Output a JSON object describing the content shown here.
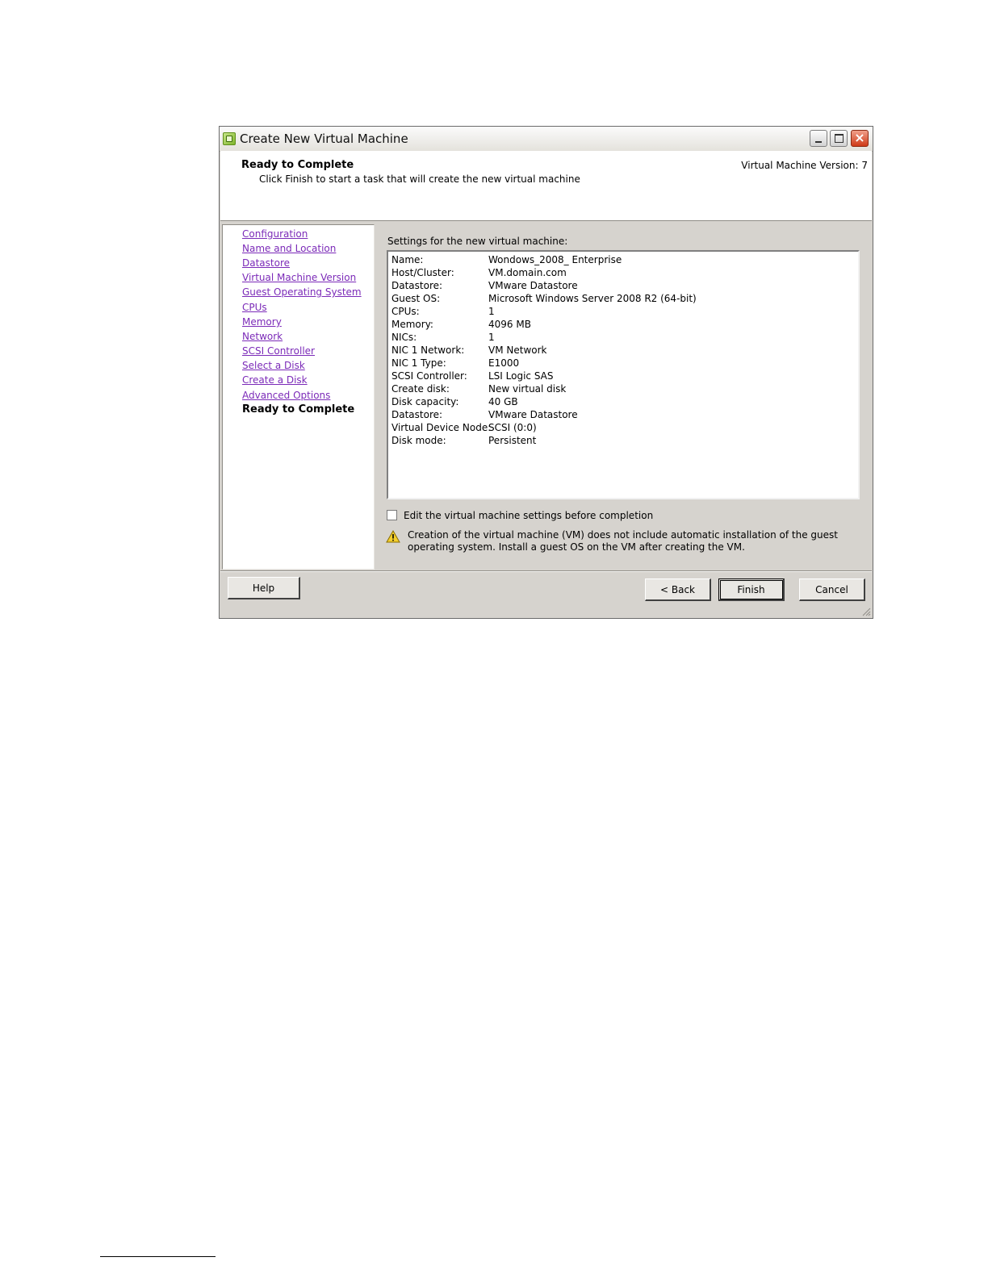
{
  "window": {
    "title": "Create New Virtual Machine",
    "icon": "vsphere-client-icon",
    "controls": [
      "minimize-icon",
      "maximize-icon",
      "close-icon"
    ]
  },
  "header": {
    "title": "Ready to Complete",
    "subtitle": "Click Finish to start a task that will create the new virtual machine",
    "version": "Virtual Machine Version: 7"
  },
  "nav": {
    "items": [
      {
        "label": "Configuration"
      },
      {
        "label": "Name and Location"
      },
      {
        "label": "Datastore"
      },
      {
        "label": "Virtual Machine Version"
      },
      {
        "label": "Guest Operating System"
      },
      {
        "label": "CPUs"
      },
      {
        "label": "Memory"
      },
      {
        "label": "Network"
      },
      {
        "label": "SCSI Controller"
      },
      {
        "label": "Select a Disk"
      },
      {
        "label": "Create a Disk"
      },
      {
        "label": "Advanced Options"
      },
      {
        "label": "Ready to Complete"
      }
    ],
    "current": "Ready to Complete",
    "link_color": "#7b2ab8"
  },
  "content": {
    "label": "Settings for the new virtual machine:",
    "settings": [
      {
        "key": "Name:",
        "value": "Wondows_2008_ Enterprise"
      },
      {
        "key": "Host/Cluster:",
        "value": "VM.domain.com"
      },
      {
        "key": "Datastore:",
        "value": "VMware Datastore"
      },
      {
        "key": "Guest OS:",
        "value": "Microsoft Windows Server 2008 R2 (64-bit)"
      },
      {
        "key": "CPUs:",
        "value": "1"
      },
      {
        "key": "Memory:",
        "value": "4096 MB"
      },
      {
        "key": "NICs:",
        "value": "1"
      },
      {
        "key": "NIC 1 Network:",
        "value": "VM Network"
      },
      {
        "key": "NIC 1 Type:",
        "value": "E1000"
      },
      {
        "key": "SCSI Controller:",
        "value": "LSI Logic SAS"
      },
      {
        "key": "Create disk:",
        "value": "New virtual disk"
      },
      {
        "key": "Disk capacity:",
        "value": "40 GB"
      },
      {
        "key": "Datastore:",
        "value": "VMware Datastore"
      },
      {
        "key": "Virtual Device Node:",
        "value": "SCSI (0:0)"
      },
      {
        "key": "Disk mode:",
        "value": "Persistent"
      }
    ],
    "edit_checkbox": {
      "label": "Edit the virtual machine settings before completion",
      "checked": false
    },
    "warning": {
      "icon": "warning-icon",
      "text": "Creation of the virtual machine (VM) does not include automatic installation of the guest operating system. Install a guest OS on the VM after creating the VM."
    }
  },
  "buttons": {
    "help": "Help",
    "back": "< Back",
    "finish": "Finish",
    "cancel": "Cancel"
  },
  "colors": {
    "dialog_bg": "#d6d3ce",
    "close_button": "#cf3a18"
  }
}
